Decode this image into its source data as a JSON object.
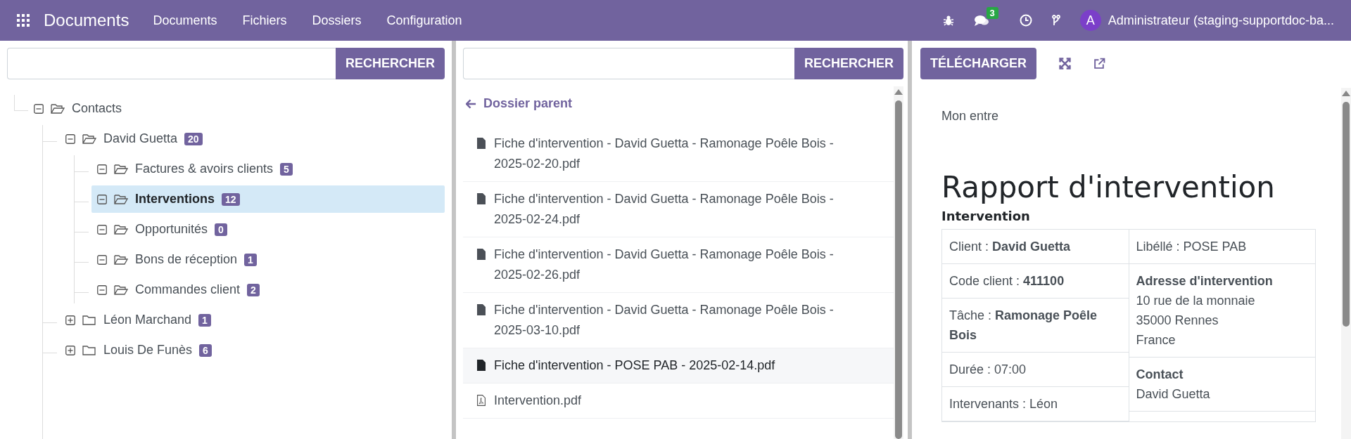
{
  "app_bar": {
    "title": "Documents",
    "menu": [
      "Documents",
      "Fichiers",
      "Dossiers",
      "Configuration"
    ],
    "messages_badge": "3",
    "user_initial": "A",
    "user_name": "Administrateur (staging-supportdoc-ba..."
  },
  "folder_panel": {
    "search_button": "RECHERCHER",
    "tree": [
      {
        "name": "Contacts",
        "expanded": true,
        "selected": false,
        "children": [
          {
            "name": "David Guetta",
            "count": "20",
            "expanded": true,
            "selected": false,
            "children": [
              {
                "name": "Factures & avoirs clients",
                "count": "5",
                "expanded": true,
                "selected": false
              },
              {
                "name": "Interventions",
                "count": "12",
                "expanded": true,
                "selected": true
              },
              {
                "name": "Opportunités",
                "count": "0",
                "expanded": true,
                "selected": false
              },
              {
                "name": "Bons de réception",
                "count": "1",
                "expanded": true,
                "selected": false
              },
              {
                "name": "Commandes client",
                "count": "2",
                "expanded": true,
                "selected": false
              }
            ]
          },
          {
            "name": "Léon Marchand",
            "count": "1",
            "expanded": false,
            "selected": false
          },
          {
            "name": "Louis De Funès",
            "count": "6",
            "expanded": false,
            "selected": false
          }
        ]
      }
    ]
  },
  "file_panel": {
    "search_button": "RECHERCHER",
    "parent_link": "Dossier parent",
    "files": [
      {
        "name": "Fiche d'intervention - David Guetta - Ramonage Poêle Bois - 2025-02-20.pdf",
        "kind": "document",
        "highlighted": false
      },
      {
        "name": "Fiche d'intervention - David Guetta - Ramonage Poêle Bois - 2025-02-24.pdf",
        "kind": "document",
        "highlighted": false
      },
      {
        "name": "Fiche d'intervention - David Guetta - Ramonage Poêle Bois - 2025-02-26.pdf",
        "kind": "document",
        "highlighted": false
      },
      {
        "name": "Fiche d'intervention - David Guetta - Ramonage Poêle Bois - 2025-03-10.pdf",
        "kind": "document",
        "highlighted": false
      },
      {
        "name": "Fiche d'intervention - POSE PAB - 2025-02-14.pdf",
        "kind": "document",
        "highlighted": true
      },
      {
        "name": "Intervention.pdf",
        "kind": "pdf",
        "highlighted": false
      }
    ]
  },
  "preview": {
    "download_button": "TÉLÉCHARGER",
    "header_text": "Mon entre",
    "title": "Rapport d'intervention",
    "section": "Intervention",
    "left_cells": [
      "Client : **David Guetta**",
      "Code client : **411100**",
      "Tâche : **Ramonage Poêle Bois**",
      "Durée : 07:00",
      "Intervenants : Léon"
    ],
    "right_cells": [
      {
        "lines": [
          "Libéllé : POSE PAB"
        ]
      },
      {
        "heading": "Adresse d'intervention",
        "lines": [
          "10 rue de la monnaie",
          "35000 Rennes",
          "France"
        ]
      },
      {
        "heading": "Contact",
        "lines": [
          "David Guetta"
        ]
      }
    ]
  }
}
